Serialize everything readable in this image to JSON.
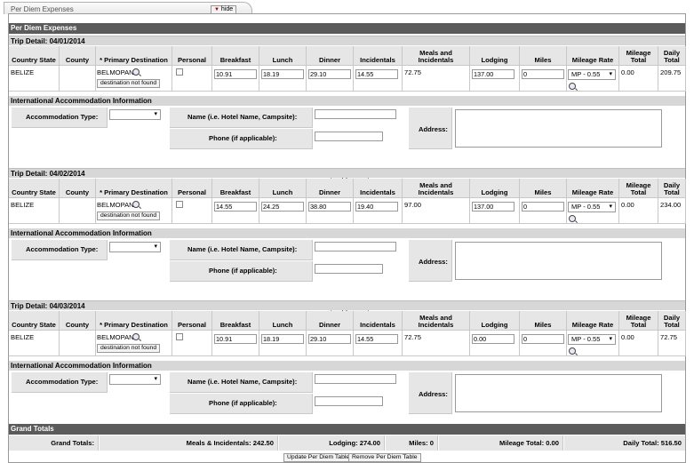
{
  "tab": {
    "title": "Per Diem Expenses",
    "hide_label": "hide"
  },
  "section_title": "Per Diem Expenses",
  "columns": {
    "country_state": "Country State",
    "county": "County",
    "primary_destination": "Primary Destination",
    "personal": "Personal",
    "breakfast": "Breakfast",
    "lunch": "Lunch",
    "dinner": "Dinner",
    "incidentals": "Incidentals",
    "meals_incidentals": "Meals and Incidentals",
    "lodging": "Lodging",
    "miles": "Miles",
    "mileage_rate": "Mileage Rate",
    "mileage_total": "Mileage Total",
    "daily_total": "Daily Total"
  },
  "intl": {
    "title": "International Accommodation Information",
    "accommodation_type": "Accommodation Type:",
    "name": "Name (i.e. Hotel Name, Campsite):",
    "phone": "Phone (if applicable):",
    "address": "Address:"
  },
  "copy_down": "Copy Down",
  "destination_not_found": "destination not found",
  "trips": [
    {
      "title": "Trip Detail: 04/01/2014",
      "country": "BELIZE",
      "destination": "BELMOPAN",
      "breakfast": "10.91",
      "lunch": "18.19",
      "dinner": "29.10",
      "incidentals": "14.55",
      "meals_incidentals": "72.75",
      "lodging": "137.00",
      "miles": "0",
      "mileage_rate": "MP - 0.55",
      "mileage_total": "0.00",
      "daily_total": "209.75"
    },
    {
      "title": "Trip Detail: 04/02/2014",
      "country": "BELIZE",
      "destination": "BELMOPAN",
      "breakfast": "14.55",
      "lunch": "24.25",
      "dinner": "38.80",
      "incidentals": "19.40",
      "meals_incidentals": "97.00",
      "lodging": "137.00",
      "miles": "0",
      "mileage_rate": "MP - 0.55",
      "mileage_total": "0.00",
      "daily_total": "234.00"
    },
    {
      "title": "Trip Detail: 04/03/2014",
      "country": "BELIZE",
      "destination": "BELMOPAN",
      "breakfast": "10.91",
      "lunch": "18.19",
      "dinner": "29.10",
      "incidentals": "14.55",
      "meals_incidentals": "72.75",
      "lodging": "0.00",
      "miles": "0",
      "mileage_rate": "MP - 0.55",
      "mileage_total": "0.00",
      "daily_total": "72.75"
    }
  ],
  "grand": {
    "title": "Grand Totals",
    "label": "Grand Totals:",
    "meals": "Meals & Incidentals: 242.50",
    "lodging": "Lodging: 274.00",
    "miles": "Miles: 0",
    "mileage": "Mileage Total: 0.00",
    "daily": "Daily Total: 516.50"
  },
  "buttons": {
    "update": "Update Per Diem Table",
    "remove": "Remove Per Diem Table"
  }
}
